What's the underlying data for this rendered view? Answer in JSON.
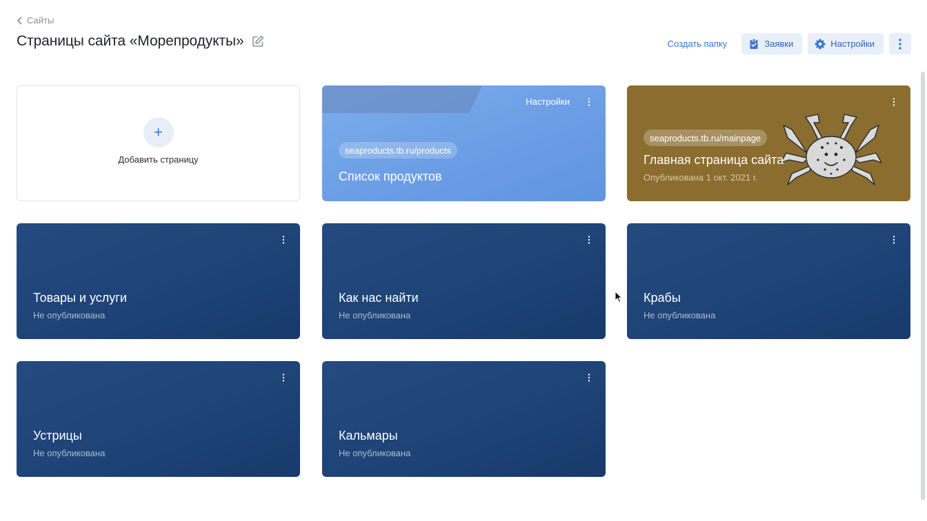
{
  "breadcrumb": {
    "label": "Сайты"
  },
  "page_title": "Страницы сайта «Морепродукты»",
  "actions": {
    "create_folder": "Создать папку",
    "requests": "Заявки",
    "settings": "Настройки"
  },
  "add_card": {
    "label": "Добавить страницу"
  },
  "cards": [
    {
      "title": "Список продуктов",
      "url": "seaproducts.tb.ru/products",
      "corner_label": "Настройки",
      "style": "light"
    },
    {
      "title": "Главная страница сайта",
      "url": "seaproducts.tb.ru/mainpage",
      "status": "Опубликована 1 окт. 2021 г.",
      "style": "olive"
    },
    {
      "title": "Товары и услуги",
      "status": "Не опубликована",
      "style": "dark"
    },
    {
      "title": "Как нас найти",
      "status": "Не опубликована",
      "style": "dark"
    },
    {
      "title": "Крабы",
      "status": "Не опубликована",
      "style": "dark"
    },
    {
      "title": "Устрицы",
      "status": "Не опубликована",
      "style": "dark"
    },
    {
      "title": "Кальмары",
      "status": "Не опубликована",
      "style": "dark"
    }
  ],
  "colors": {
    "accent": "#3b74d1",
    "card_dark": "#1f4478",
    "card_light": "#6d9fe6",
    "card_olive": "#8a6d2f",
    "button_bg": "#e9eff8"
  },
  "icons": [
    "chevron-left-icon",
    "edit-icon",
    "clipboard-check-icon",
    "gear-icon",
    "more-vertical-icon",
    "plus-icon",
    "crab-illustration",
    "mouse-cursor-icon"
  ]
}
